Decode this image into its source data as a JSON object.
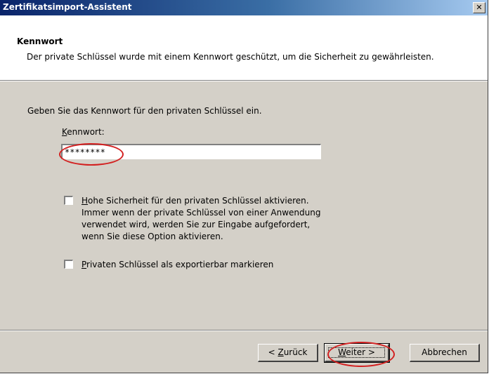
{
  "window": {
    "title": "Zertifikatsimport-Assistent",
    "close_glyph": "✕"
  },
  "header": {
    "title": "Kennwort",
    "description": "Der private Schlüssel wurde mit einem Kennwort geschützt, um die Sicherheit zu gewährleisten."
  },
  "body": {
    "prompt": "Geben Sie das Kennwort für den privaten Schlüssel ein.",
    "password_label_accel": "K",
    "password_label_rest": "ennwort:",
    "password_value": "********"
  },
  "options": [
    {
      "accel": "H",
      "rest": "ohe Sicherheit für den privaten Schlüssel aktivieren.",
      "line2": "Immer wenn der private Schlüssel von einer Anwendung",
      "line3": "verwendet wird, werden Sie zur Eingabe aufgefordert,",
      "line4": "wenn Sie diese Option aktivieren.",
      "checked": false
    },
    {
      "accel": "P",
      "rest": "rivaten Schlüssel als exportierbar markieren",
      "checked": false
    }
  ],
  "buttons": {
    "back_prefix": "< ",
    "back_accel": "Z",
    "back_rest": "urück",
    "next_accel": "W",
    "next_rest": "eiter >",
    "cancel": "Abbrechen"
  },
  "colors": {
    "annotation": "#d32020",
    "titlebar_start": "#0a246a",
    "dialog_face": "#d4d0c8"
  }
}
